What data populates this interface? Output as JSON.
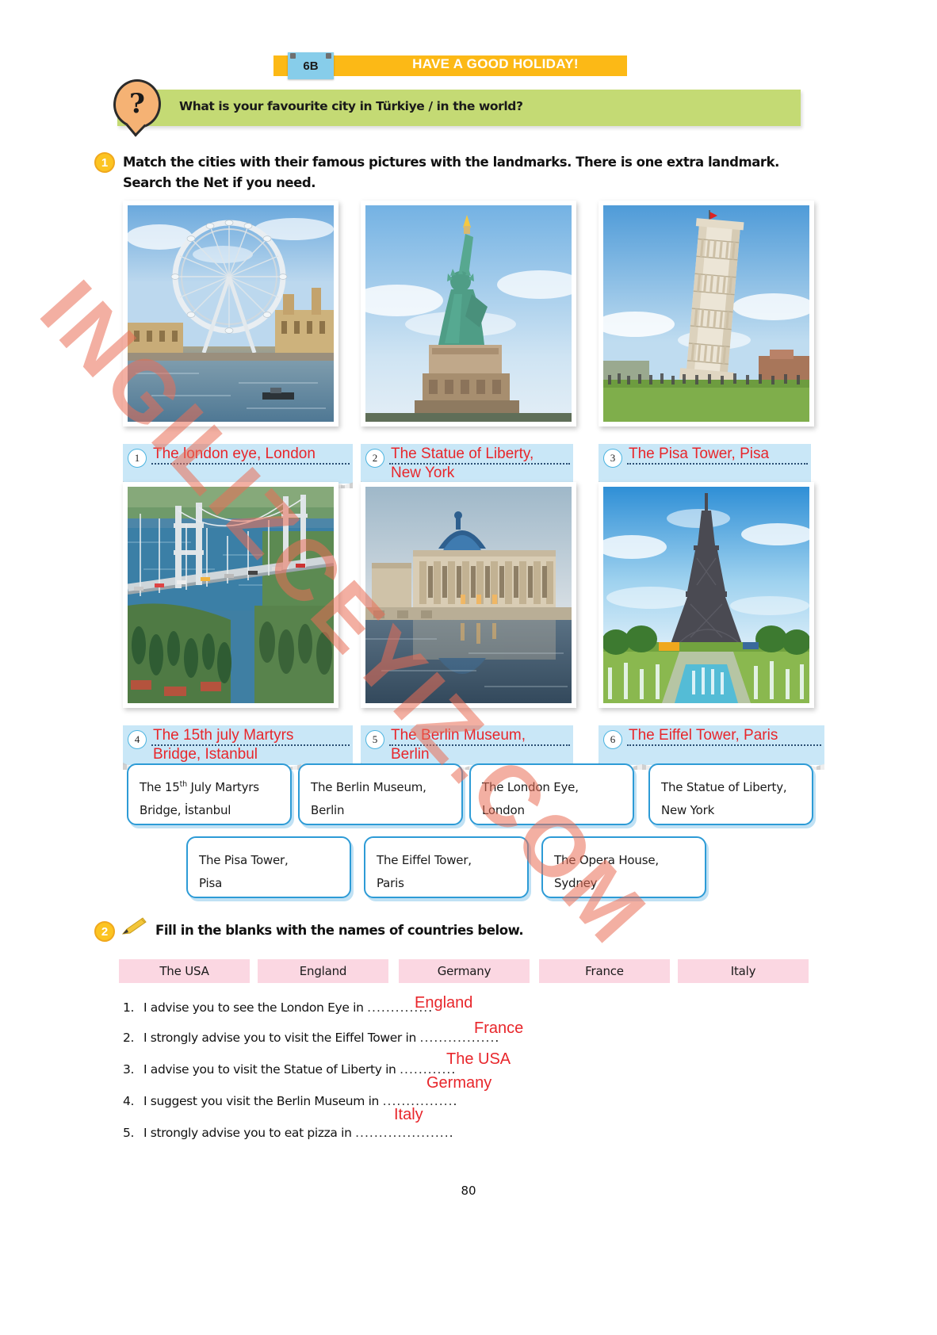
{
  "header": {
    "unit_code": "6B",
    "title": "HAVE A GOOD HOLIDAY!"
  },
  "question_banner": {
    "icon": "question-mark-icon",
    "text": "What is your favourite city in Türkiye / in the world?"
  },
  "exercise1": {
    "number": "1",
    "instruction_line1": "Match the cities with their famous pictures with the landmarks. There is one extra landmark.",
    "instruction_line2": "Search the Net if you need.",
    "items": [
      {
        "num": "1",
        "image": "london-eye-photo",
        "answer_line1": "The london eye, London",
        "answer_line2": ""
      },
      {
        "num": "2",
        "image": "statue-of-liberty-photo",
        "answer_line1": "The Statue of Liberty,",
        "answer_line2": "New York"
      },
      {
        "num": "3",
        "image": "pisa-tower-photo",
        "answer_line1": "The Pisa Tower, Pisa",
        "answer_line2": ""
      },
      {
        "num": "4",
        "image": "bosphorus-bridge-photo",
        "answer_line1": "The 15th july Martyrs",
        "answer_line2": "Bridge, Istanbul"
      },
      {
        "num": "5",
        "image": "berlin-museum-photo",
        "answer_line1": "The Berlin Museum,",
        "answer_line2": "Berlin"
      },
      {
        "num": "6",
        "image": "eiffel-tower-photo",
        "answer_line1": "The Eiffel Tower, Paris",
        "answer_line2": ""
      }
    ],
    "word_bank_row1": [
      {
        "line1_pre": "The 15",
        "sup": "th",
        "line1_post": " July Martyrs",
        "line2": "Bridge, İstanbul"
      },
      {
        "line1_pre": "The Berlin Museum,",
        "sup": "",
        "line1_post": "",
        "line2": "Berlin"
      },
      {
        "line1_pre": "The London Eye,",
        "sup": "",
        "line1_post": "",
        "line2": "London"
      },
      {
        "line1_pre": "The Statue of Liberty,",
        "sup": "",
        "line1_post": "",
        "line2": "New York"
      }
    ],
    "word_bank_row2": [
      {
        "line1_pre": "The Pisa Tower,",
        "sup": "",
        "line1_post": "",
        "line2": "Pisa"
      },
      {
        "line1_pre": "The Eiffel Tower,",
        "sup": "",
        "line1_post": "",
        "line2": "Paris"
      },
      {
        "line1_pre": "The Opera House,",
        "sup": "",
        "line1_post": "",
        "line2": "Sydney"
      }
    ]
  },
  "exercise2": {
    "number": "2",
    "icon": "pencil-icon",
    "instruction": "Fill in the blanks with the names of countries below.",
    "country_chips": [
      "The USA",
      "England",
      "Germany",
      "France",
      "Italy"
    ],
    "sentences": [
      {
        "idx": "1.",
        "text": "I advise you to see the London Eye in",
        "answer": "England",
        "dots": ".............",
        "end": "."
      },
      {
        "idx": "2.",
        "text": "I strongly advise you to visit the Eiffel Tower in",
        "answer": "France",
        "dots": "................",
        "end": "."
      },
      {
        "idx": "3.",
        "text": "I advise you to visit the Statue of Liberty in",
        "answer": "The USA",
        "dots": "...........",
        "end": "."
      },
      {
        "idx": "4.",
        "text": "I suggest you visit the Berlin Museum in",
        "answer": "Germany",
        "dots": "...............",
        "end": "."
      },
      {
        "idx": "5.",
        "text": "I strongly advise you to eat pizza in",
        "answer": "Italy",
        "dots": "....................",
        "end": "."
      }
    ]
  },
  "watermark": "INGILIZCEYIZ.COM",
  "page_number": "80",
  "colors": {
    "header_orange": "#fcb916",
    "unit_tab_blue": "#87cdea",
    "banner_green": "#c4da74",
    "answer_strip_blue": "#c9e7f7",
    "handwriting_red": "#e8262b",
    "box_border_blue": "#2d9bd6",
    "chip_pink": "#fbd7e2",
    "badge_yellow": "#fcc421"
  }
}
